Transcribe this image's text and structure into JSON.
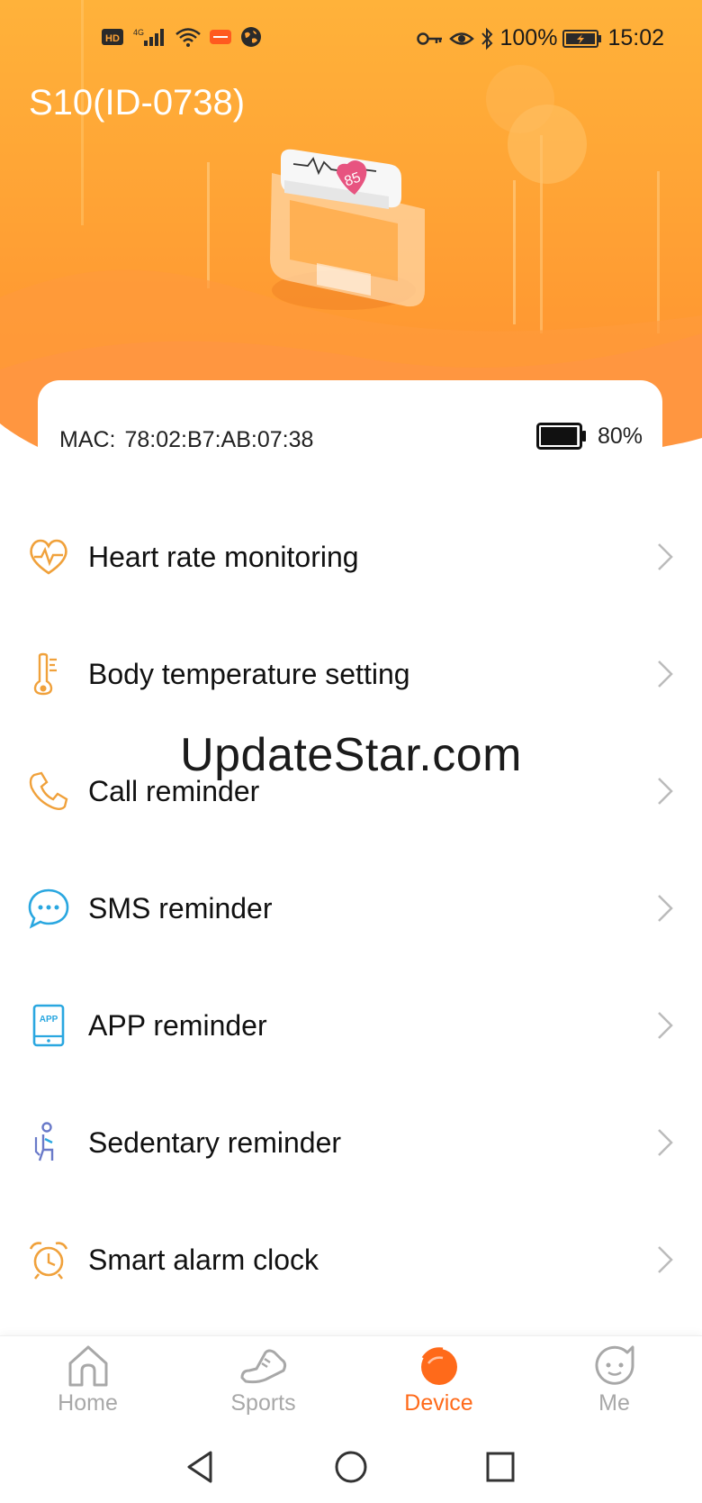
{
  "status_bar": {
    "left_icons": [
      "hd-icon",
      "4g-signal-icon",
      "wifi-icon",
      "app-icon",
      "globe-icon"
    ],
    "hd_label": "HD",
    "battery_percent": "100%",
    "time": "15:02"
  },
  "header": {
    "device_title": "S10(ID-0738)",
    "watch_heart_value": "85"
  },
  "device_card": {
    "mac_label": "MAC:",
    "mac_value": "78:02:B7:AB:07:38",
    "battery_percent": "80%",
    "battery_level": 0.8
  },
  "menu": [
    {
      "label": "Heart rate monitoring",
      "icon": "heart-rate-icon"
    },
    {
      "label": "Body temperature setting",
      "icon": "thermometer-icon"
    },
    {
      "label": "Call reminder",
      "icon": "phone-icon"
    },
    {
      "label": "SMS reminder",
      "icon": "chat-bubble-icon"
    },
    {
      "label": "APP reminder",
      "icon": "app-phone-icon"
    },
    {
      "label": "Sedentary reminder",
      "icon": "sedentary-person-icon"
    },
    {
      "label": "Smart alarm clock",
      "icon": "alarm-clock-icon"
    }
  ],
  "app_icon_text": "APP",
  "watermark": "UpdateStar.com",
  "bottom_nav": [
    {
      "label": "Home",
      "icon": "home-icon",
      "active": false
    },
    {
      "label": "Sports",
      "icon": "sneaker-icon",
      "active": false
    },
    {
      "label": "Device",
      "icon": "device-icon",
      "active": true
    },
    {
      "label": "Me",
      "icon": "face-icon",
      "active": false
    }
  ],
  "colors": {
    "header_orange": "#ffa335",
    "accent": "#ff6a1a",
    "inactive_nav": "#a8a8a8",
    "icon_orange": "#f0a13b",
    "icon_blue": "#2aa7e0"
  }
}
